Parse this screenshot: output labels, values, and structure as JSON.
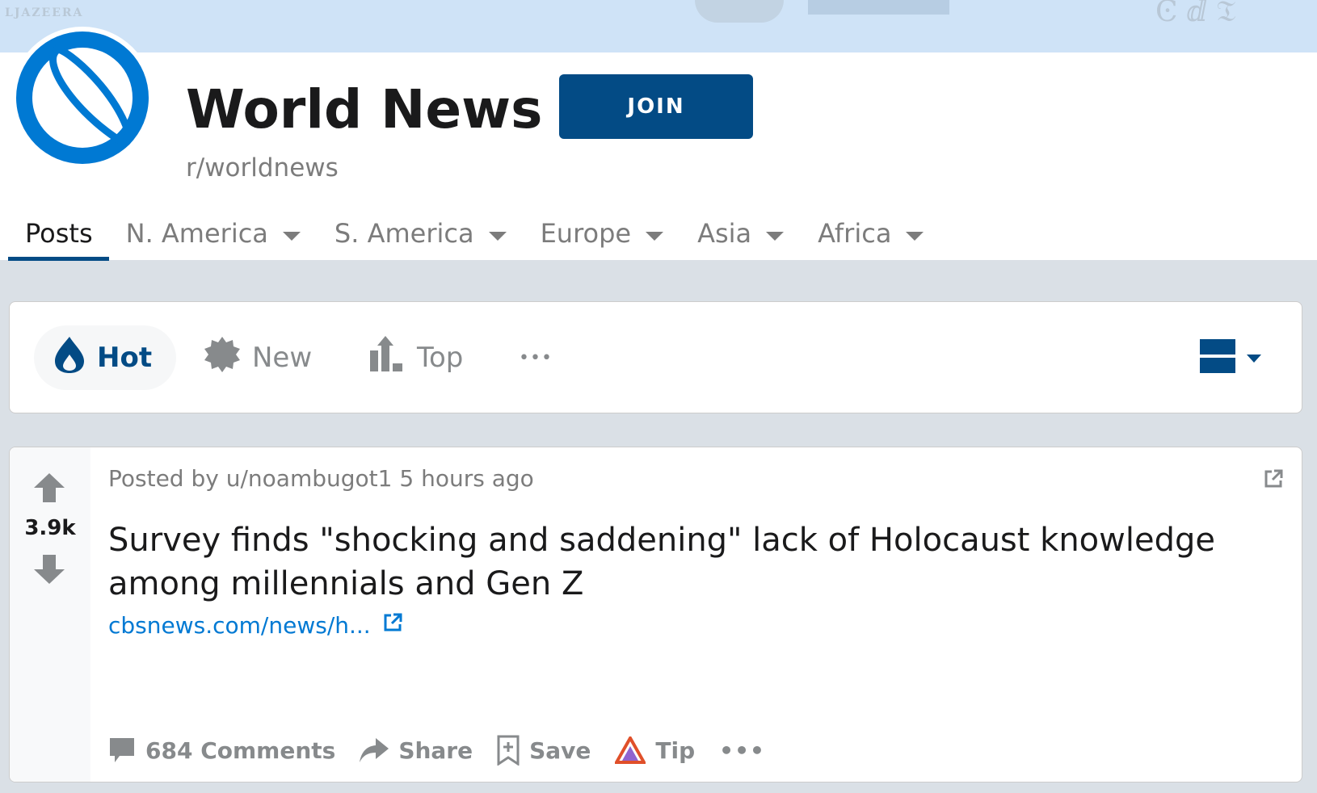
{
  "banner": {
    "text": "LJAZEERA"
  },
  "header": {
    "title": "World News",
    "join_label": "JOIN",
    "subreddit": "r/worldnews"
  },
  "tabs": [
    {
      "label": "Posts",
      "active": true,
      "dropdown": false
    },
    {
      "label": "N. America",
      "active": false,
      "dropdown": true
    },
    {
      "label": "S. America",
      "active": false,
      "dropdown": true
    },
    {
      "label": "Europe",
      "active": false,
      "dropdown": true
    },
    {
      "label": "Asia",
      "active": false,
      "dropdown": true
    },
    {
      "label": "Africa",
      "active": false,
      "dropdown": true
    }
  ],
  "sort": {
    "hot": "Hot",
    "new": "New",
    "top": "Top",
    "more": "•••"
  },
  "post": {
    "score": "3.9k",
    "posted_by_prefix": "Posted by",
    "author": "u/noambugot1",
    "time": "5 hours ago",
    "title": "Survey finds \"shocking and saddening\" lack of Holocaust knowledge among millennials and Gen Z",
    "link_text": "cbsnews.com/news/h...",
    "comments": "684 Comments",
    "share": "Share",
    "save": "Save",
    "tip": "Tip",
    "more": "•••"
  },
  "colors": {
    "brand_dark": "#034b85",
    "brand_blue": "#0079d3",
    "page_bg": "#dae0e6"
  }
}
